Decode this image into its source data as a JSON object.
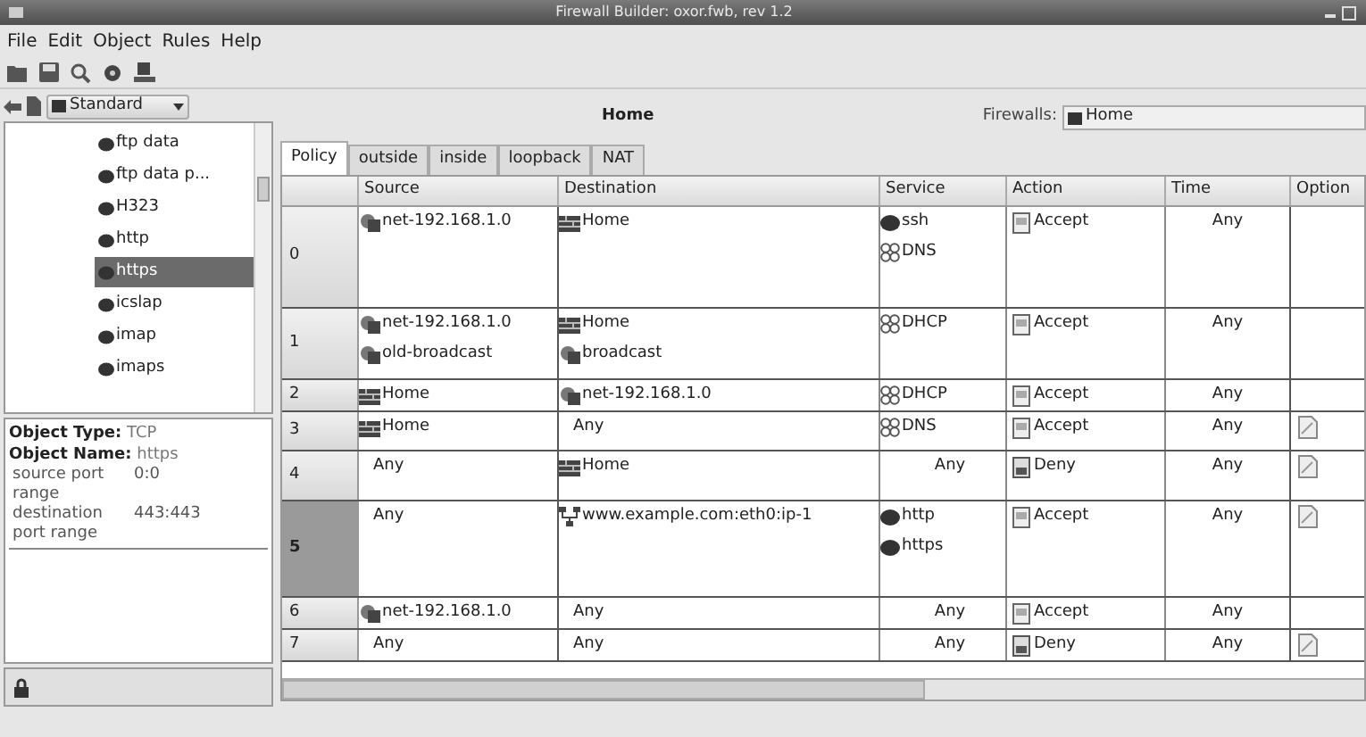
{
  "window": {
    "title": "Firewall Builder: oxor.fwb, rev 1.2"
  },
  "menu": [
    "File",
    "Edit",
    "Object",
    "Rules",
    "Help"
  ],
  "library": {
    "value": "Standard"
  },
  "tree": [
    {
      "label": "ftp data",
      "selected": false
    },
    {
      "label": "ftp data p...",
      "selected": false
    },
    {
      "label": "H323",
      "selected": false
    },
    {
      "label": "http",
      "selected": false
    },
    {
      "label": "https",
      "selected": true
    },
    {
      "label": "icslap",
      "selected": false
    },
    {
      "label": "imap",
      "selected": false
    },
    {
      "label": "imaps",
      "selected": false
    }
  ],
  "info": [
    {
      "label": "Object Type:",
      "value": "TCP"
    },
    {
      "label": "Object Name:",
      "value": "https"
    }
  ],
  "info_rows": [
    {
      "label": "source port range",
      "value": "0:0"
    },
    {
      "label": "destination port range",
      "value": "443:443"
    }
  ],
  "header": {
    "title": "Home",
    "firewalls_label": "Firewalls:",
    "firewall": "Home"
  },
  "tabs": [
    {
      "label": "Policy",
      "selected": true
    },
    {
      "label": "outside",
      "selected": false
    },
    {
      "label": "inside",
      "selected": false
    },
    {
      "label": "loopback",
      "selected": false
    },
    {
      "label": "NAT",
      "selected": false
    }
  ],
  "columns": [
    "Source",
    "Destination",
    "Service",
    "Action",
    "Time",
    "Option"
  ],
  "rows": [
    {
      "number": "0",
      "selected": false,
      "source": [
        {
          "kind": "network",
          "name": "net-192.168.1.0"
        }
      ],
      "destination": [
        {
          "kind": "firewall",
          "name": "Home"
        }
      ],
      "service": [
        {
          "kind": "tcp",
          "name": "ssh"
        },
        {
          "kind": "group",
          "name": "DNS"
        }
      ],
      "action": {
        "kind": "accept",
        "label": "Accept"
      },
      "time": "Any",
      "options": false
    },
    {
      "number": "1",
      "selected": false,
      "source": [
        {
          "kind": "network",
          "name": "net-192.168.1.0"
        },
        {
          "kind": "network",
          "name": "old-broadcast"
        }
      ],
      "destination": [
        {
          "kind": "firewall",
          "name": "Home"
        },
        {
          "kind": "network",
          "name": "broadcast"
        }
      ],
      "service": [
        {
          "kind": "group",
          "name": "DHCP"
        }
      ],
      "action": {
        "kind": "accept",
        "label": "Accept"
      },
      "time": "Any",
      "options": false
    },
    {
      "number": "2",
      "selected": false,
      "source": [
        {
          "kind": "firewall",
          "name": "Home"
        }
      ],
      "destination": [
        {
          "kind": "network",
          "name": "net-192.168.1.0"
        }
      ],
      "service": [
        {
          "kind": "group",
          "name": "DHCP"
        }
      ],
      "action": {
        "kind": "accept",
        "label": "Accept"
      },
      "time": "Any",
      "options": false
    },
    {
      "number": "3",
      "selected": false,
      "source": [
        {
          "kind": "firewall",
          "name": "Home"
        }
      ],
      "destination": [
        {
          "kind": "any",
          "name": "Any"
        }
      ],
      "service": [
        {
          "kind": "group",
          "name": "DNS"
        }
      ],
      "action": {
        "kind": "accept",
        "label": "Accept"
      },
      "time": "Any",
      "options": true
    },
    {
      "number": "4",
      "selected": false,
      "source": [
        {
          "kind": "any",
          "name": "Any"
        }
      ],
      "destination": [
        {
          "kind": "firewall",
          "name": "Home"
        }
      ],
      "service": [
        {
          "kind": "any",
          "name": "Any"
        }
      ],
      "action": {
        "kind": "deny",
        "label": "Deny"
      },
      "time": "Any",
      "options": true
    },
    {
      "number": "5",
      "selected": true,
      "source": [
        {
          "kind": "any",
          "name": "Any"
        }
      ],
      "destination": [
        {
          "kind": "interface",
          "name": "www.example.com:eth0:ip-1"
        }
      ],
      "service": [
        {
          "kind": "tcp",
          "name": "http"
        },
        {
          "kind": "tcp",
          "name": "https"
        }
      ],
      "action": {
        "kind": "accept",
        "label": "Accept"
      },
      "time": "Any",
      "options": true
    },
    {
      "number": "6",
      "selected": false,
      "source": [
        {
          "kind": "network",
          "name": "net-192.168.1.0"
        }
      ],
      "destination": [
        {
          "kind": "any",
          "name": "Any"
        }
      ],
      "service": [
        {
          "kind": "any",
          "name": "Any"
        }
      ],
      "action": {
        "kind": "accept",
        "label": "Accept"
      },
      "time": "Any",
      "options": false
    },
    {
      "number": "7",
      "selected": false,
      "source": [
        {
          "kind": "any",
          "name": "Any"
        }
      ],
      "destination": [
        {
          "kind": "any",
          "name": "Any"
        }
      ],
      "service": [
        {
          "kind": "any",
          "name": "Any"
        }
      ],
      "action": {
        "kind": "deny",
        "label": "Deny"
      },
      "time": "Any",
      "options": true
    }
  ]
}
